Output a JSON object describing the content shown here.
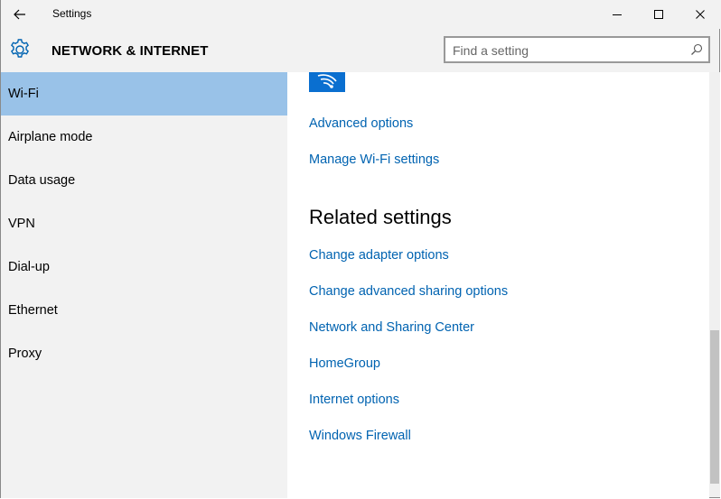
{
  "window": {
    "app_title": "Settings"
  },
  "header": {
    "section_title": "NETWORK & INTERNET",
    "search_placeholder": "Find a setting"
  },
  "sidebar": {
    "items": [
      {
        "label": "Wi-Fi",
        "active": true
      },
      {
        "label": "Airplane mode",
        "active": false
      },
      {
        "label": "Data usage",
        "active": false
      },
      {
        "label": "VPN",
        "active": false
      },
      {
        "label": "Dial-up",
        "active": false
      },
      {
        "label": "Ethernet",
        "active": false
      },
      {
        "label": "Proxy",
        "active": false
      }
    ]
  },
  "content": {
    "links_top": [
      "Advanced options",
      "Manage Wi-Fi settings"
    ],
    "related_title": "Related settings",
    "related_links": [
      "Change adapter options",
      "Change advanced sharing options",
      "Network and Sharing Center",
      "HomeGroup",
      "Internet options",
      "Windows Firewall"
    ]
  },
  "colors": {
    "accent": "#0063b1",
    "selected": "#99c2e8",
    "tile": "#0a6fd0"
  },
  "icons": [
    "back-arrow-icon",
    "minimize-icon",
    "maximize-icon",
    "close-icon",
    "gear-icon",
    "search-icon",
    "wifi-icon"
  ]
}
